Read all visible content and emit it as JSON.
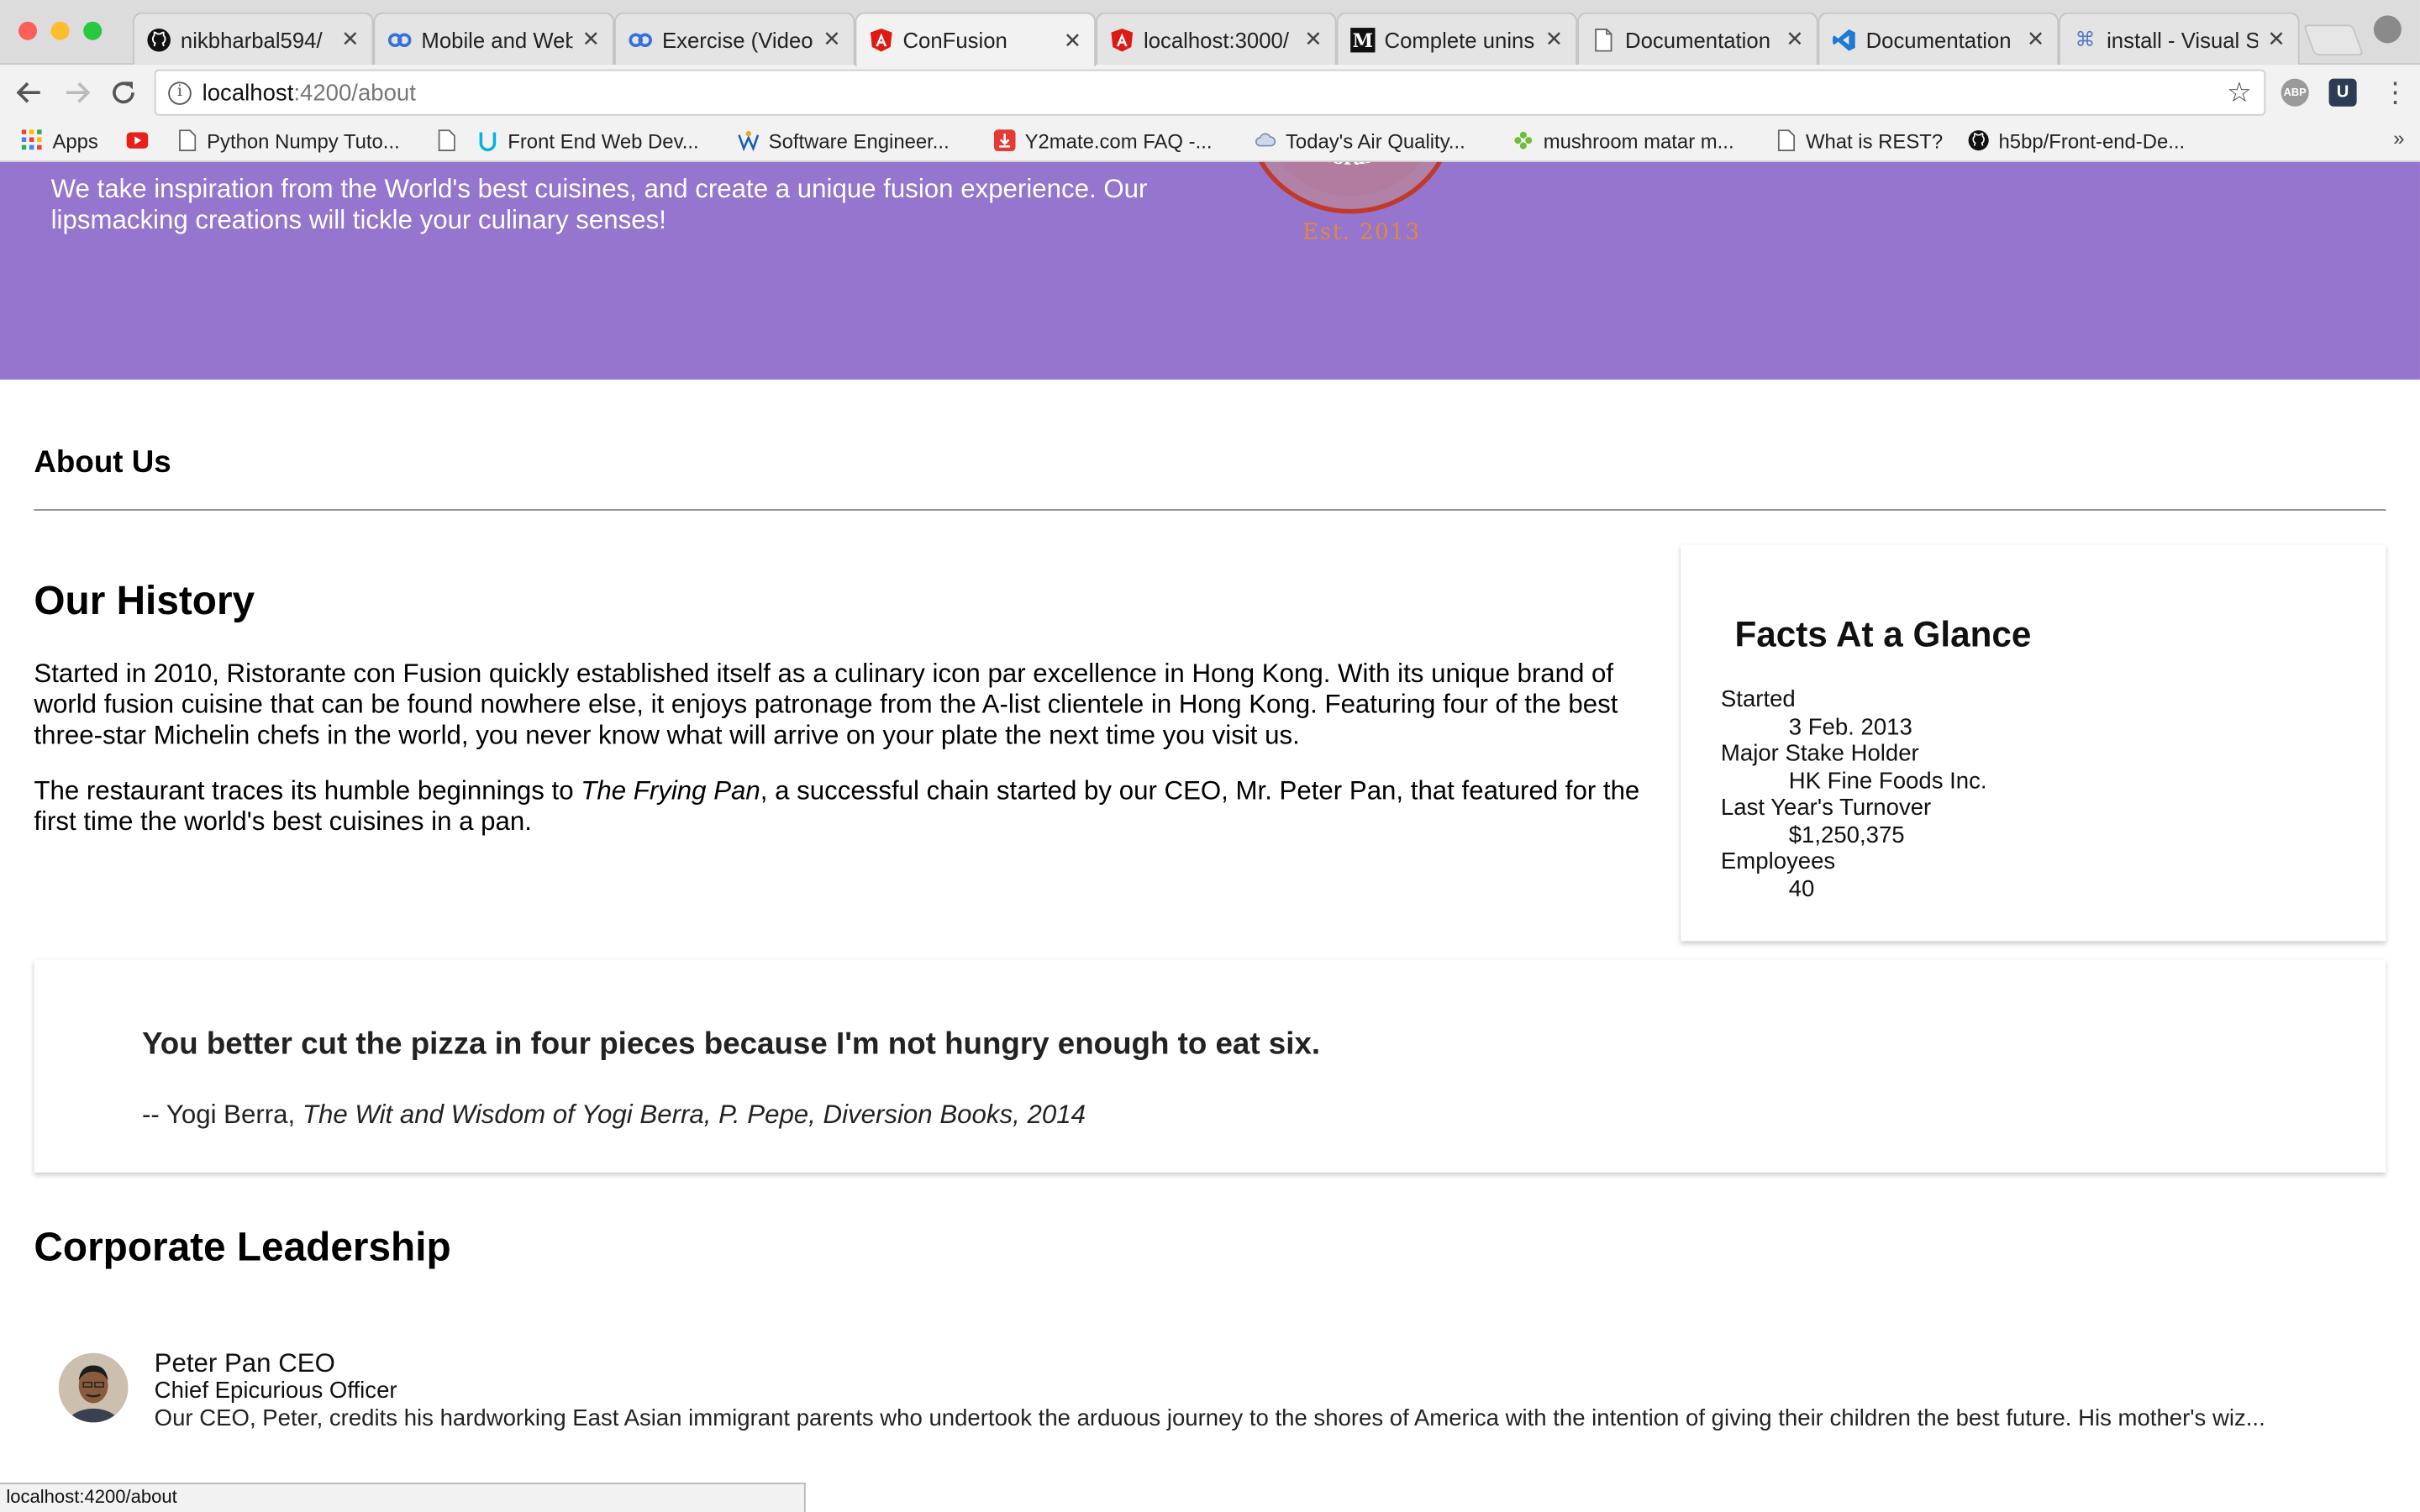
{
  "browser": {
    "tabs": [
      {
        "title": "nikbharbal594/",
        "icon": "github-icon"
      },
      {
        "title": "Mobile and Web",
        "icon": "coursera-icon"
      },
      {
        "title": "Exercise (Video",
        "icon": "coursera-icon"
      },
      {
        "title": "ConFusion",
        "icon": "angular-icon",
        "active": true
      },
      {
        "title": "localhost:3000/",
        "icon": "angular-icon"
      },
      {
        "title": "Complete unins",
        "icon": "medium-icon"
      },
      {
        "title": "Documentation",
        "icon": "document-icon"
      },
      {
        "title": "Documentation",
        "icon": "vscode-icon"
      },
      {
        "title": "install - Visual S",
        "icon": "command-icon"
      }
    ],
    "url_host": "localhost",
    "url_path": ":4200/about",
    "extensions": [
      "ABP",
      "U"
    ],
    "bookmarks": [
      {
        "label": "Apps",
        "icon": "apps-grid-icon"
      },
      {
        "label": "",
        "icon": "youtube-icon"
      },
      {
        "label": "Python Numpy Tuto...",
        "icon": "page-icon"
      },
      {
        "label": "",
        "icon": "page-icon"
      },
      {
        "label": "Front End Web Dev...",
        "icon": "udacity-icon"
      },
      {
        "label": "Software Engineer...",
        "icon": "w-icon"
      },
      {
        "label": "Y2mate.com FAQ -...",
        "icon": "download-icon"
      },
      {
        "label": "Today's Air Quality...",
        "icon": "cloud-icon"
      },
      {
        "label": "mushroom matar m...",
        "icon": "leaf-icon"
      },
      {
        "label": "What is REST?",
        "icon": "page-icon"
      },
      {
        "label": "h5bp/Front-end-De...",
        "icon": "github-icon"
      }
    ],
    "bookmarks_more": "»",
    "status_url": "localhost:4200/about"
  },
  "colors": {
    "jumbotron": "#9575cd",
    "logo_ring": "#c0392b",
    "logo_text": "#e08a3a"
  },
  "jumbotron": {
    "tagline": "We take inspiration from the World's best cuisines, and create a unique fusion experience. Our lipsmacking creations will tickle your culinary senses!",
    "logo_text": "Ristorante con Fusion",
    "logo_est": "Est. 2013"
  },
  "about": {
    "heading": "About Us",
    "history_heading": "Our History",
    "history_p1": "Started in 2010, Ristorante con Fusion quickly established itself as a culinary icon par excellence in Hong Kong. With its unique brand of world fusion cuisine that can be found nowhere else, it enjoys patronage from the A-list clientele in Hong Kong. Featuring four of the best three-star Michelin chefs in the world, you never know what will arrive on your plate the next time you visit us.",
    "history_p2_before": "The restaurant traces its humble beginnings to ",
    "history_p2_em": "The Frying Pan",
    "history_p2_after": ", a successful chain started by our CEO, Mr. Peter Pan, that featured for the first time the world's best cuisines in a pan."
  },
  "facts": {
    "heading": "Facts At a Glance",
    "items": [
      {
        "term": "Started",
        "value": "3 Feb. 2013"
      },
      {
        "term": "Major Stake Holder",
        "value": "HK Fine Foods Inc."
      },
      {
        "term": "Last Year's Turnover",
        "value": "$1,250,375"
      },
      {
        "term": "Employees",
        "value": "40"
      }
    ]
  },
  "quote": {
    "text": "You better cut the pizza in four pieces because I'm not hungry enough to eat six.",
    "author_prefix": "-- Yogi Berra, ",
    "source": "The Wit and Wisdom of Yogi Berra, P. Pepe, Diversion Books, 2014"
  },
  "leadership": {
    "heading": "Corporate Leadership",
    "leaders": [
      {
        "name": "Peter Pan CEO",
        "title": "Chief Epicurious Officer",
        "description": "Our CEO, Peter, credits his hardworking East Asian immigrant parents who undertook the arduous journey to the shores of America with the intention of giving their children the best future. His mother's wiz..."
      }
    ]
  }
}
